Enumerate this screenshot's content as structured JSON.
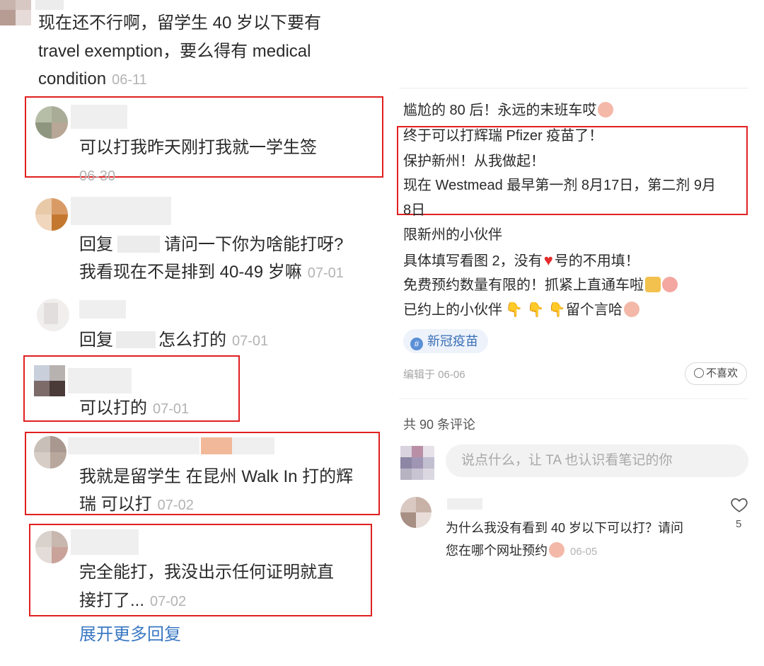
{
  "left": {
    "top_comment": {
      "line1": "现在还不行啊，留学生 40 岁以下要有",
      "line2": "travel exemption，要么得有 medical",
      "line3": "condition",
      "date": "06-11"
    },
    "replies": [
      {
        "text": "可以打我昨天刚打我就一学生签",
        "date": "06-30"
      },
      {
        "line1_prefix": "回复",
        "line1_suffix": "请问一下你为啥能打呀?",
        "line2": "我看现在不是排到 40-49 岁嘛",
        "date": "07-01"
      },
      {
        "prefix": "回复",
        "suffix": "怎么打的",
        "date": "07-01"
      },
      {
        "text": "可以打的",
        "date": "07-01"
      },
      {
        "line1": "我就是留学生 在昆州 Walk In 打的辉",
        "line2": "瑞 可以打",
        "date": "07-02"
      },
      {
        "line1": "完全能打，我没出示任何证明就直",
        "line2": "接打了...",
        "date": "07-02"
      }
    ],
    "expand_label": "展开更多回复"
  },
  "right": {
    "post_lines": [
      "尴尬的 80 后！永远的末班车哎",
      "终于可以打辉瑞 Pfizer 疫苗了！",
      "保护新州！从我做起！",
      "现在 Westmead 最早第一剂 8月17日，第二剂 9月",
      "8日",
      "限新州的小伙伴",
      "具体填写看图 2，没有",
      "号的不用填！",
      "免费预约数量有限的！抓紧上直通车啦",
      "已约上的小伙伴",
      "留个言哈"
    ],
    "tag": "新冠疫苗",
    "edited": "编辑于 06-06",
    "dislike_label": "不喜欢",
    "comment_count": "共 90 条评论",
    "input_placeholder": "说点什么，让 TA 也认识看笔记的你",
    "comment": {
      "line1": "为什么我没有看到 40 岁以下可以打？请问",
      "line2": "您在哪个网址预约",
      "date": "06-05",
      "likes": "5"
    }
  },
  "colors": {
    "highlight_box": "#e02020",
    "link": "#3a78c3",
    "meta": "#b3b3b3"
  }
}
